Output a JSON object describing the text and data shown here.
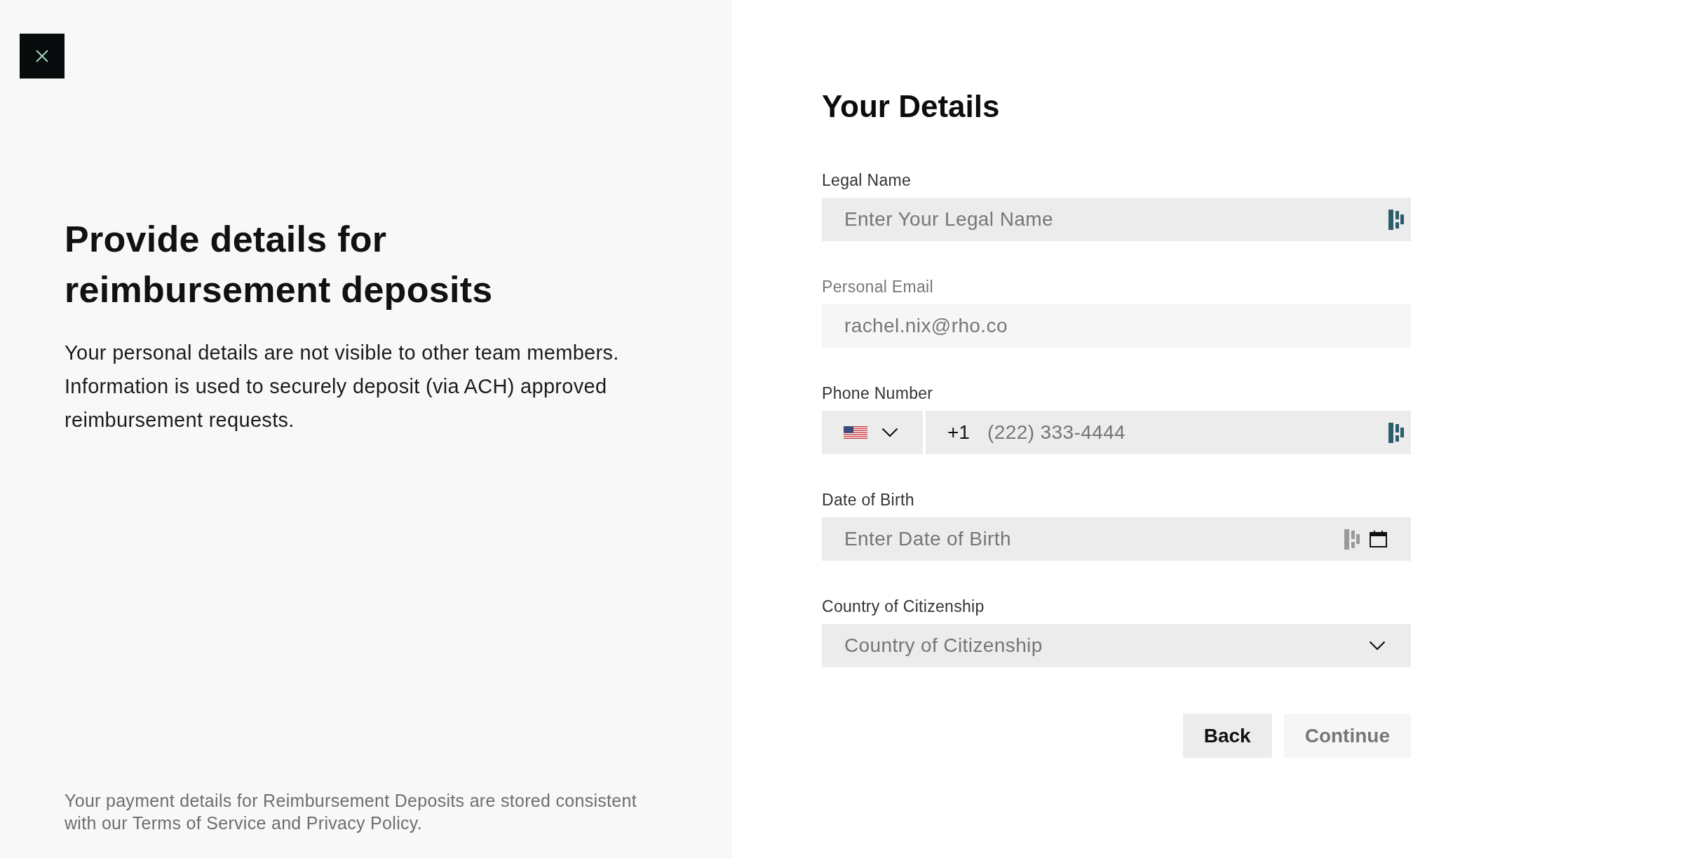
{
  "intro": {
    "title": "Provide details for reimbursement deposits",
    "description": "Your personal details are not visible to other team members. Information is used to securely deposit (via ACH) approved reimbursement requests.",
    "footnote": "Your payment details for Reimbursement Deposits are stored consistent with our Terms of Service and Privacy Policy."
  },
  "form": {
    "title": "Your Details",
    "fields": [
      {
        "kind": "text",
        "label": "Legal Name",
        "placeholder": "Enter Your Legal Name",
        "disabled": false,
        "autofill_active": true
      },
      {
        "kind": "text",
        "label": "Personal Email",
        "value": "rachel.nix@rho.co",
        "disabled": true
      },
      {
        "kind": "phone",
        "label": "Phone Number",
        "country_code": "+1",
        "placeholder": "(222) 333-4444",
        "disabled": false,
        "autofill_active": true
      },
      {
        "kind": "date",
        "label": "Date of Birth",
        "placeholder": "Enter Date of Birth",
        "disabled": false,
        "autofill_active": false
      },
      {
        "kind": "select",
        "label": "Country of Citizenship",
        "placeholder": "Country of Citizenship",
        "disabled": false
      }
    ],
    "buttons": [
      {
        "label": "Back",
        "disabled": false
      },
      {
        "label": "Continue",
        "disabled": true
      }
    ]
  }
}
